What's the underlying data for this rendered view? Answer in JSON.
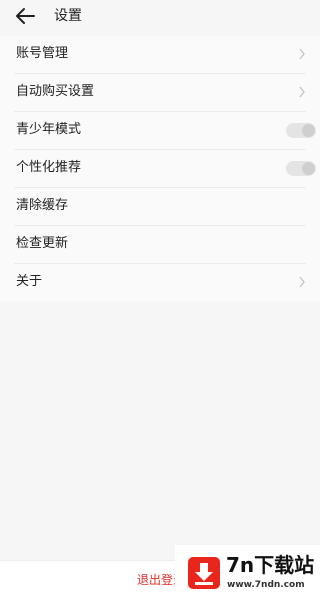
{
  "header": {
    "back_icon": "arrow-left-icon",
    "title": "设置"
  },
  "settings": {
    "items": [
      {
        "label": "账号管理",
        "control": "chevron",
        "icon": "chevron-right-icon"
      },
      {
        "label": "自动购买设置",
        "control": "chevron",
        "icon": "chevron-right-icon"
      },
      {
        "label": "青少年模式",
        "control": "toggle",
        "on": false
      },
      {
        "label": "个性化推荐",
        "control": "toggle",
        "on": false
      },
      {
        "label": "清除缓存",
        "control": "none"
      },
      {
        "label": "检查更新",
        "control": "none"
      },
      {
        "label": "关于",
        "control": "chevron",
        "icon": "chevron-right-icon"
      }
    ]
  },
  "footer": {
    "logout_label": "退出登录"
  },
  "watermark": {
    "title": "7n下载站",
    "url": "www.7ndn.com",
    "icon": "download-arrow-icon"
  },
  "colors": {
    "background": "#f6f6f6",
    "logout_text": "#e0302a",
    "watermark_badge": "#e8261c"
  }
}
